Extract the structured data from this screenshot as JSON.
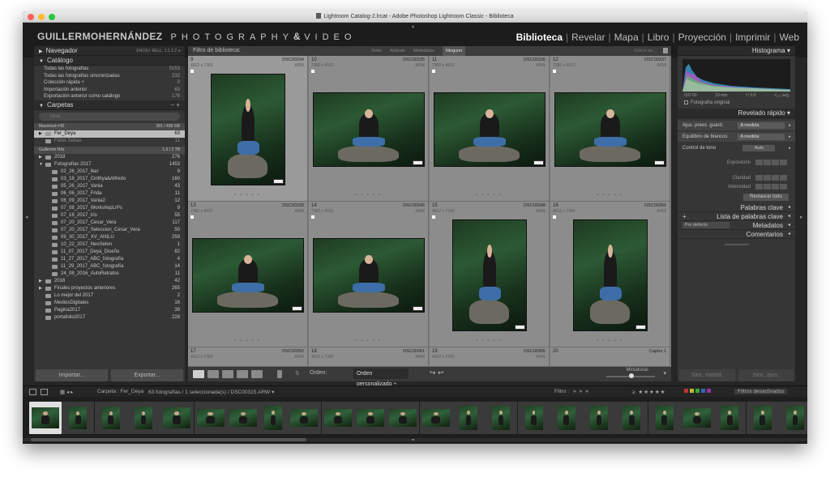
{
  "window": {
    "title": "Lightroom Catalog-2.lrcat - Adobe Photoshop Lightroom Classic - Biblioteca",
    "traffic_colors": [
      "#ff5f57",
      "#febc2e",
      "#28c840"
    ]
  },
  "identity": {
    "name": "GUILLERMOHERNÁNDEZ",
    "tag": "PHOTOGRAPHY",
    "amp": "&",
    "tag2": "VIDEO"
  },
  "modules": [
    "Biblioteca",
    "Revelar",
    "Mapa",
    "Libro",
    "Proyección",
    "Imprimir",
    "Web"
  ],
  "left": {
    "navigator": {
      "title": "Navegador",
      "extra": "ENCAJ.   RELL.   1:1   1:2 ◂"
    },
    "catalog": {
      "title": "Catálogo",
      "rows": [
        {
          "label": "Todas las fotografías",
          "count": "5153"
        },
        {
          "label": "Todas las fotografías sincronizadas",
          "count": "232"
        },
        {
          "label": "Colección rápida +",
          "count": "0"
        },
        {
          "label": "Importación anterior",
          "count": "63"
        },
        {
          "label": "Exportación anterior como catálogo",
          "count": "176"
        }
      ]
    },
    "folders": {
      "title": "Carpetas",
      "extra": "−  +",
      "search_placeholder": "Filtrar",
      "volumes": [
        {
          "name": "Macintosh HD",
          "size": "381 / 499 GB"
        },
        {
          "name": "Guillermo Hdz",
          "size": "1.6 / 2 TB"
        }
      ],
      "vol1_items": [
        {
          "name": "Fer_Deya",
          "count": "63",
          "sel": true
        },
        {
          "name": "Fotos Sebas",
          "count": "11",
          "sel": false
        }
      ],
      "vol2_items": [
        {
          "name": "2018",
          "count": "276",
          "level": 1,
          "arrow": "▶"
        },
        {
          "name": "Fotografías 2017",
          "count": "1453",
          "level": 1,
          "arrow": "▼"
        },
        {
          "name": "02_26_2017_Iker",
          "count": "9",
          "level": 2,
          "arrow": ""
        },
        {
          "name": "03_18_2017_Cinthya&Alfredo",
          "count": "160",
          "level": 2,
          "arrow": ""
        },
        {
          "name": "05_26_2017_Vania",
          "count": "43",
          "level": 2,
          "arrow": ""
        },
        {
          "name": "06_06_2017_Frida",
          "count": "11",
          "level": 2,
          "arrow": ""
        },
        {
          "name": "06_09_2017_Vania2",
          "count": "12",
          "level": 2,
          "arrow": ""
        },
        {
          "name": "07_08_2017_WorkshopLrPs",
          "count": "9",
          "level": 2,
          "arrow": ""
        },
        {
          "name": "07_16_2017_Iris",
          "count": "55",
          "level": 2,
          "arrow": ""
        },
        {
          "name": "07_20_2017_Cesar_Vera",
          "count": "117",
          "level": 2,
          "arrow": ""
        },
        {
          "name": "07_20_2017_Seleccion_Cesar_Vera",
          "count": "50",
          "level": 2,
          "arrow": ""
        },
        {
          "name": "09_30_2017_XV_ANILU",
          "count": "259",
          "level": 2,
          "arrow": ""
        },
        {
          "name": "10_22_2017_NeoSelen",
          "count": "1",
          "level": 2,
          "arrow": ""
        },
        {
          "name": "11_07_2017_Deya_Diseño",
          "count": "82",
          "level": 2,
          "arrow": ""
        },
        {
          "name": "11_27_2017_ABC_fotografía",
          "count": "4",
          "level": 2,
          "arrow": ""
        },
        {
          "name": "11_29_2017_ABC_fotografía",
          "count": "14",
          "level": 2,
          "arrow": ""
        },
        {
          "name": "24_08_2016_AutoRetratos",
          "count": "11",
          "level": 2,
          "arrow": ""
        },
        {
          "name": "2016",
          "count": "42",
          "level": 1,
          "arrow": "▶"
        },
        {
          "name": "Finales proyectos anteriores",
          "count": "265",
          "level": 1,
          "arrow": "▶"
        },
        {
          "name": "Lo mejor del 2017",
          "count": "2",
          "level": 1,
          "arrow": ""
        },
        {
          "name": "MediosDigitales",
          "count": "16",
          "level": 1,
          "arrow": ""
        },
        {
          "name": "Pagina2017",
          "count": "39",
          "level": 1,
          "arrow": ""
        },
        {
          "name": "portafolio2017",
          "count": "228",
          "level": 1,
          "arrow": ""
        }
      ]
    },
    "import_label": "Importar...",
    "export_label": "Exportar..."
  },
  "center": {
    "filter_title": "Filtro de biblioteca:",
    "filter_opts": [
      "Texto",
      "Atributo",
      "Metadatos",
      "Ninguno"
    ],
    "filter_selected": "Ninguno",
    "filter_preset": "Filtros de...",
    "cells": [
      {
        "idx": "9",
        "file": "DSC00334",
        "dim": "4912 x 7360",
        "ext": "ARW",
        "portrait": true
      },
      {
        "idx": "10",
        "file": "DSC00335",
        "dim": "7360 x 4912",
        "ext": "ARW",
        "portrait": false
      },
      {
        "idx": "11",
        "file": "DSC00336",
        "dim": "7360 x 4912",
        "ext": "ARW",
        "portrait": false
      },
      {
        "idx": "12",
        "file": "DSC00337",
        "dim": "7360 x 4912",
        "ext": "ARW",
        "portrait": false
      },
      {
        "idx": "13",
        "file": "DSC00339",
        "dim": "7360 x 4912",
        "ext": "ARW",
        "portrait": false
      },
      {
        "idx": "14",
        "file": "DSC00345",
        "dim": "7360 x 4912",
        "ext": "ARW",
        "portrait": false
      },
      {
        "idx": "15",
        "file": "DSC00348",
        "dim": "4912 x 7360",
        "ext": "ARW",
        "portrait": true
      },
      {
        "idx": "16",
        "file": "DSC00350",
        "dim": "4912 x 7360",
        "ext": "ARW",
        "portrait": true
      },
      {
        "idx": "17",
        "file": "DSC00352",
        "dim": "4912 x 7360",
        "ext": "ARW",
        "portrait": true
      },
      {
        "idx": "18",
        "file": "DSC00361",
        "dim": "4912 x 7360",
        "ext": "ARW",
        "portrait": true
      },
      {
        "idx": "19",
        "file": "DSC00365",
        "dim": "4912 x 7360",
        "ext": "ARW",
        "portrait": true
      },
      {
        "idx": "20",
        "file": "Captur 1",
        "dim": "",
        "ext": "",
        "portrait": true
      }
    ],
    "sort_label": "Orden:",
    "sort_value": "Orden personalizado ÷",
    "thumbs_label": "Miniaturas"
  },
  "right": {
    "histogram": {
      "title": "Histograma",
      "iso": "ISO 80",
      "focal": "19 mm",
      "aperture": "f / 9,0",
      "shutter": "¹⁄₁₂₅ seg",
      "original_label": "Fotografía original"
    },
    "quick": {
      "title": "Revelado rápido",
      "preset_label": "Ajus. prees. guard.",
      "preset_value": "A medida",
      "wb_label": "Equilibrio de blancos",
      "wb_value": "A medida",
      "tone_label": "Control de tono",
      "tone_value": "Auto",
      "exposure_label": "Exposición",
      "clarity_label": "Claridad",
      "vibrance_label": "Intensidad",
      "restore_label": "Restaurar todo"
    },
    "keywords_label": "Palabras clave",
    "keyword_list_label": "Lista de palabras clave",
    "metadata_preset": "Por defecto",
    "metadata_label": "Metadatos",
    "comments_label": "Comentarios",
    "sync_meta": "Sinc. metad.",
    "sync_settings": "Sinc. ajus."
  },
  "stripbar": {
    "path": "Carpeta : Fer_Deya",
    "count": "63 fotografías / 1 seleccionada(s) / DSC00315.ARW ▾",
    "filter_label": "Filtro :",
    "stars": "≥ ★★★★★",
    "filter_off": "Filtros desactivados"
  },
  "colors": {
    "accent": "#d9d9d9",
    "panel": "#363636",
    "grid_bg": "#7a7a7a"
  }
}
